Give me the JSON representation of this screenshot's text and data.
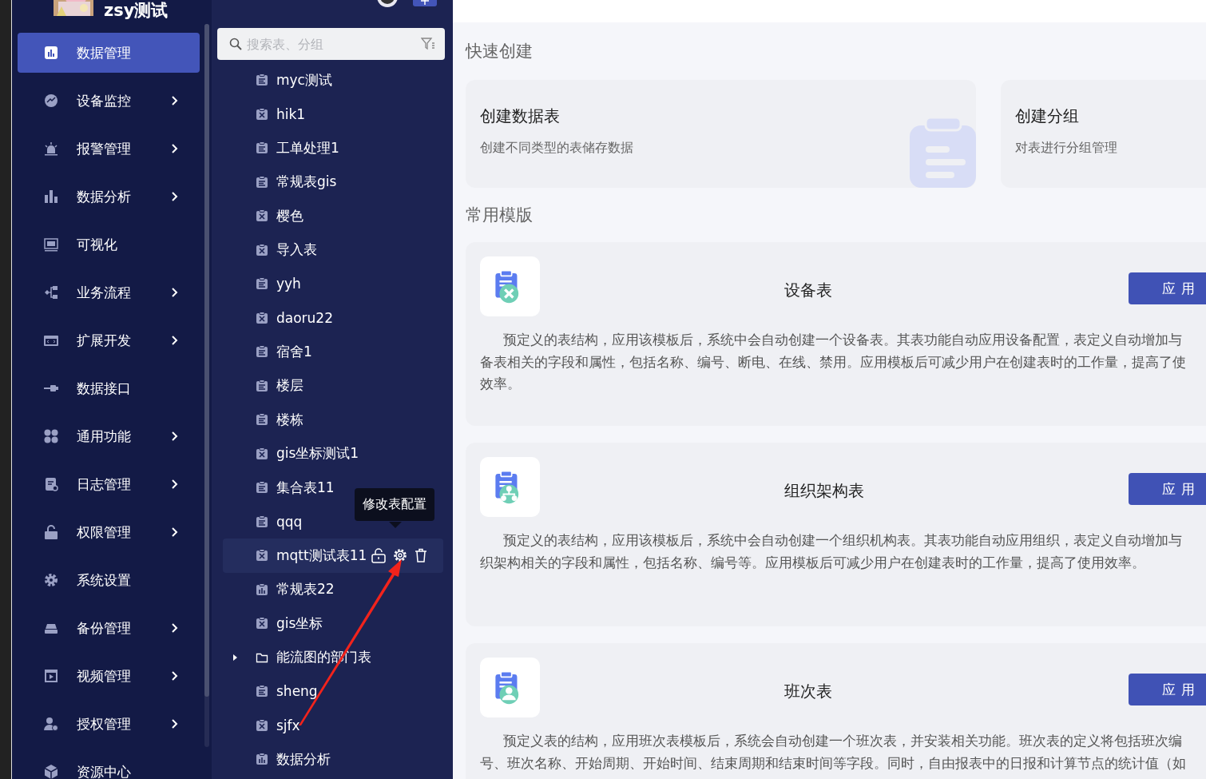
{
  "user": {
    "name": "zsy测试"
  },
  "sidebar": {
    "items": [
      {
        "label": "数据管理",
        "selected": true,
        "has_submenu": false
      },
      {
        "label": "设备监控",
        "selected": false,
        "has_submenu": true
      },
      {
        "label": "报警管理",
        "selected": false,
        "has_submenu": true
      },
      {
        "label": "数据分析",
        "selected": false,
        "has_submenu": true
      },
      {
        "label": "可视化",
        "selected": false,
        "has_submenu": false
      },
      {
        "label": "业务流程",
        "selected": false,
        "has_submenu": true
      },
      {
        "label": "扩展开发",
        "selected": false,
        "has_submenu": true
      },
      {
        "label": "数据接口",
        "selected": false,
        "has_submenu": false
      },
      {
        "label": "通用功能",
        "selected": false,
        "has_submenu": true
      },
      {
        "label": "日志管理",
        "selected": false,
        "has_submenu": true
      },
      {
        "label": "权限管理",
        "selected": false,
        "has_submenu": true
      },
      {
        "label": "系统设置",
        "selected": false,
        "has_submenu": false
      },
      {
        "label": "备份管理",
        "selected": false,
        "has_submenu": true
      },
      {
        "label": "视频管理",
        "selected": false,
        "has_submenu": true
      },
      {
        "label": "授权管理",
        "selected": false,
        "has_submenu": true
      },
      {
        "label": "资源中心",
        "selected": false,
        "has_submenu": false
      }
    ]
  },
  "table_panel": {
    "search": {
      "placeholder": "搜索表、分组"
    },
    "tooltip": "修改表配置",
    "items": [
      {
        "label": "myc测试",
        "kind": "doc",
        "selected": false
      },
      {
        "label": "hik1",
        "kind": "tool",
        "selected": false
      },
      {
        "label": "工单处理1",
        "kind": "doc",
        "selected": false
      },
      {
        "label": "常规表gis",
        "kind": "doc",
        "selected": false
      },
      {
        "label": "樱色",
        "kind": "tool",
        "selected": false
      },
      {
        "label": "导入表",
        "kind": "tool",
        "selected": false
      },
      {
        "label": "yyh",
        "kind": "doc",
        "selected": false
      },
      {
        "label": "daoru22",
        "kind": "tool",
        "selected": false
      },
      {
        "label": "宿舍1",
        "kind": "doc",
        "selected": false
      },
      {
        "label": "楼层",
        "kind": "doc",
        "selected": false
      },
      {
        "label": "楼栋",
        "kind": "doc",
        "selected": false
      },
      {
        "label": "gis坐标测试1",
        "kind": "tool",
        "selected": false
      },
      {
        "label": "集合表11",
        "kind": "doc",
        "selected": false
      },
      {
        "label": "qqq",
        "kind": "doc",
        "selected": false
      },
      {
        "label": "mqtt测试表11",
        "kind": "tool",
        "selected": true
      },
      {
        "label": "常规表22",
        "kind": "chart",
        "selected": false
      },
      {
        "label": "gis坐标",
        "kind": "tool",
        "selected": false
      },
      {
        "label": "能流图的部门表",
        "kind": "folder",
        "selected": false,
        "expanded": false
      },
      {
        "label": "sheng",
        "kind": "doc",
        "selected": false
      },
      {
        "label": "sjfx",
        "kind": "tool",
        "selected": false
      },
      {
        "label": "数据分析",
        "kind": "chart",
        "selected": false
      }
    ]
  },
  "main": {
    "quick_create": {
      "title": "快速创建",
      "cards": [
        {
          "title": "创建数据表",
          "subtitle": "创建不同类型的表储存数据"
        },
        {
          "title": "创建分组",
          "subtitle": "对表进行分组管理"
        }
      ]
    },
    "templates": {
      "title": "常用模版",
      "items": [
        {
          "kind": "tool",
          "title": "设备表",
          "button": "应用",
          "lines": [
            "预定义的表结构，应用该模板后，系统中会自动创建一个设备表。其表功能自动应用设备配置，表定义自动增加与",
            "备表相关的字段和属性，包括名称、编号、断电、在线、禁用。应用模板后可减少用户在创建表时的工作量，提高了使",
            "效率。"
          ]
        },
        {
          "kind": "org",
          "title": "组织架构表",
          "button": "应用",
          "lines": [
            "预定义的表结构，应用该模板后，系统中会自动创建一个组织机构表。其表功能自动应用组织，表定义自动增加与",
            "织架构相关的字段和属性，包括名称、编号等。应用模板后可减少用户在创建表时的工作量，提高了使用效率。"
          ]
        },
        {
          "kind": "shift",
          "title": "班次表",
          "button": "应用",
          "lines": [
            "预定义表的结构，应用班次表模板后，系统会自动创建一个班次表，并安装相关功能。班次表的定义将包括班次编",
            "号、班次名称、开始周期、开始时间、结束周期和结束时间等字段。同时，自由报表中的日报和计算节点的统计值（如"
          ]
        }
      ]
    }
  }
}
